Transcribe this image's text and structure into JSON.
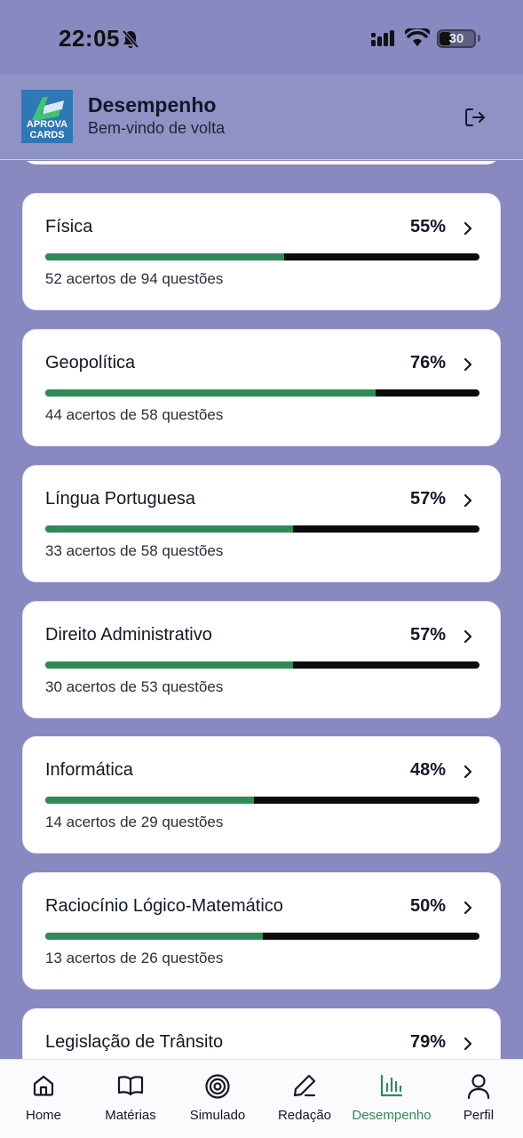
{
  "status_bar": {
    "time": "22:05",
    "battery": "30"
  },
  "header": {
    "logo_line1": "APROVA",
    "logo_line2": "CARDS",
    "title": "Desempenho",
    "subtitle": "Bem-vindo de volta"
  },
  "subjects": [
    {
      "name": "Física",
      "percent_label": "55%",
      "progress": 0.55,
      "detail": "52 acertos de 94 questões"
    },
    {
      "name": "Geopolítica",
      "percent_label": "76%",
      "progress": 0.76,
      "detail": "44 acertos de 58 questões"
    },
    {
      "name": "Língua Portuguesa",
      "percent_label": "57%",
      "progress": 0.57,
      "detail": "33 acertos de 58 questões"
    },
    {
      "name": "Direito Administrativo",
      "percent_label": "57%",
      "progress": 0.57,
      "detail": "30 acertos de 53 questões"
    },
    {
      "name": "Informática",
      "percent_label": "48%",
      "progress": 0.48,
      "detail": "14 acertos de 29 questões"
    },
    {
      "name": "Raciocínio Lógico-Matemático",
      "percent_label": "50%",
      "progress": 0.5,
      "detail": "13 acertos de 26 questões"
    },
    {
      "name": "Legislação de Trânsito",
      "percent_label": "79%",
      "progress": 0.79,
      "detail": ""
    }
  ],
  "nav": {
    "home": "Home",
    "materias": "Matérias",
    "simulado": "Simulado",
    "redacao": "Redação",
    "desempenho": "Desempenho",
    "perfil": "Perfil",
    "active": "desempenho"
  },
  "colors": {
    "background": "#8789c0",
    "progress_fill": "#2e8b57",
    "progress_track": "#0b0b0d",
    "active_nav": "#2e8b57"
  }
}
